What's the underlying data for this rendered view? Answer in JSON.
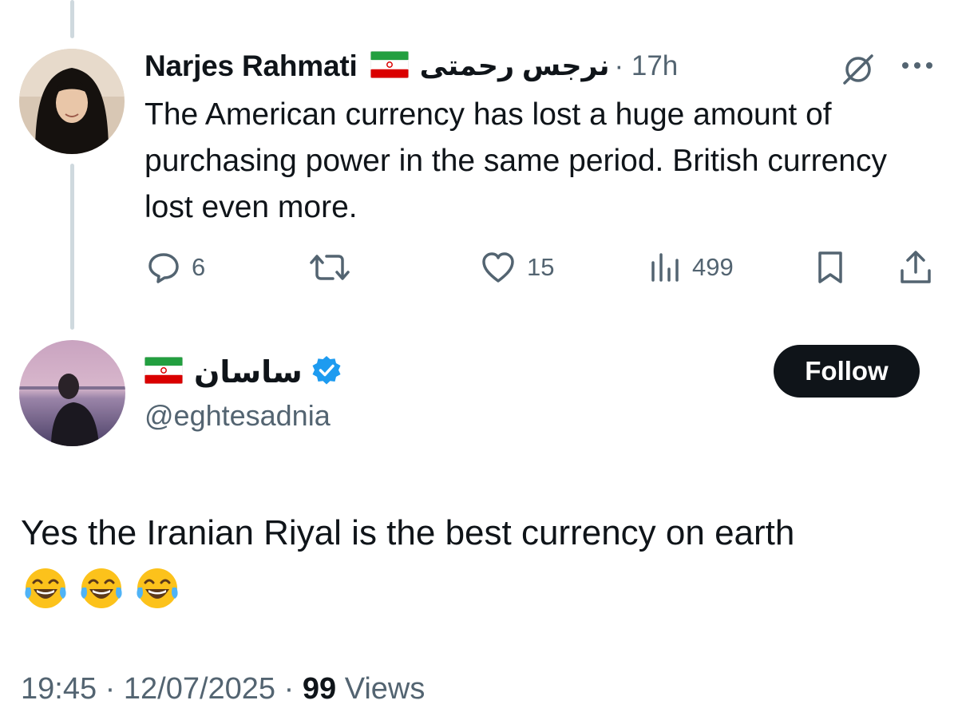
{
  "parent_tweet": {
    "author_name": "Narjes Rahmati",
    "author_name_fa": "نرجس رحمتی",
    "separator": "·",
    "time": "17h",
    "text": "The American currency has lost a huge amount of purchasing power in the same period. British currency lost even more.",
    "icons": {
      "flag": "iran-flag-icon",
      "grok": "grok-icon",
      "more": "more-options-icon"
    },
    "actions": {
      "replies": "6",
      "retweets": "",
      "likes": "15",
      "views": "499"
    }
  },
  "reply_tweet": {
    "display_name": "ساسان",
    "handle": "@eghtesadnia",
    "verified": true,
    "follow_label": "Follow",
    "text": "Yes the Iranian Riyal is the best currency on earth",
    "emojis": [
      "😂",
      "😂",
      "😂"
    ],
    "meta": {
      "time": "19:45",
      "separator": "·",
      "date": "12/07/2025",
      "views_count": "99",
      "views_label": "Views"
    }
  },
  "colors": {
    "text_primary": "#0f1419",
    "text_secondary": "#536471",
    "thread_line": "#cfd9de",
    "verified_blue": "#1d9bf0",
    "follow_bg": "#0f1419"
  }
}
